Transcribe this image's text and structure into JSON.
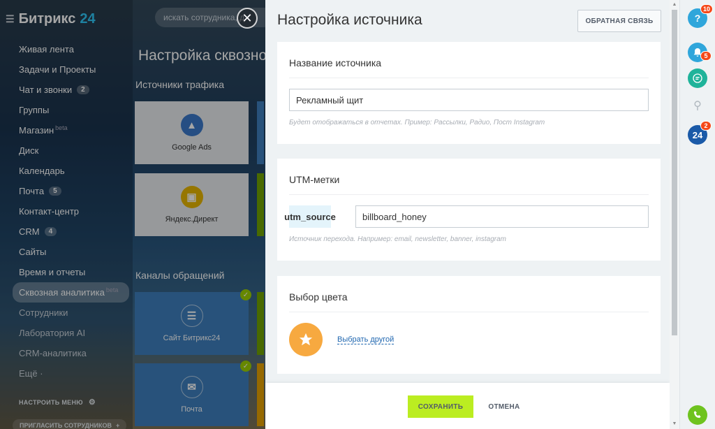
{
  "app": {
    "logo_text": "Битрикс",
    "logo_num": "24"
  },
  "search": {
    "placeholder": "искать сотрудника, д"
  },
  "sidebar": {
    "items": [
      {
        "label": "Живая лента"
      },
      {
        "label": "Задачи и Проекты"
      },
      {
        "label": "Чат и звонки",
        "counter": "2"
      },
      {
        "label": "Группы"
      },
      {
        "label": "Магазин",
        "sup": "beta"
      },
      {
        "label": "Диск"
      },
      {
        "label": "Календарь"
      },
      {
        "label": "Почта",
        "counter": "5"
      },
      {
        "label": "Контакт-центр"
      },
      {
        "label": "CRM",
        "counter": "4"
      },
      {
        "label": "Сайты"
      },
      {
        "label": "Время и отчеты"
      },
      {
        "label": "Сквозная аналитика",
        "sup": "beta",
        "active": true
      },
      {
        "label": "Сотрудники"
      },
      {
        "label": "Лаборатория AI"
      },
      {
        "label": "CRM-аналитика"
      },
      {
        "label": "Ещё ·"
      }
    ],
    "configure_menu": "НАСТРОИТЬ МЕНЮ",
    "invite": "ПРИГЛАСИТЬ СОТРУДНИКОВ"
  },
  "background_page": {
    "title": "Настройка сквозно",
    "traffic_sources": "Источники трафика",
    "tiles": [
      {
        "label": "Google Ads"
      },
      {
        "label": "Яндекс.Директ"
      }
    ],
    "channels": "Каналы обращений",
    "channel_tiles": [
      {
        "label": "Сайт Битрикс24"
      },
      {
        "label": "Почта"
      }
    ]
  },
  "slider": {
    "title": "Настройка источника",
    "feedback_button": "ОБРАТНАЯ СВЯЗЬ",
    "name_card": {
      "heading": "Название источника",
      "value": "Рекламный щит",
      "hint": "Будет отображаться в отчетах. Пример: Рассылки, Радио, Пост Instagram"
    },
    "utm_card": {
      "heading": "UTM-метки",
      "label": "utm_source",
      "value": "billboard_honey",
      "hint": "Источник перехода. Например: email, newsletter, banner, instagram"
    },
    "color_card": {
      "heading": "Выбор цвета",
      "color": "#f7a940",
      "link": "Выбрать другой"
    },
    "footer": {
      "save": "СОХРАНИТЬ",
      "cancel": "ОТМЕНА"
    }
  },
  "rightbar": {
    "help_badge": "10",
    "notifications_badge": "5",
    "b24_badge": "2",
    "b24_label": "24"
  }
}
